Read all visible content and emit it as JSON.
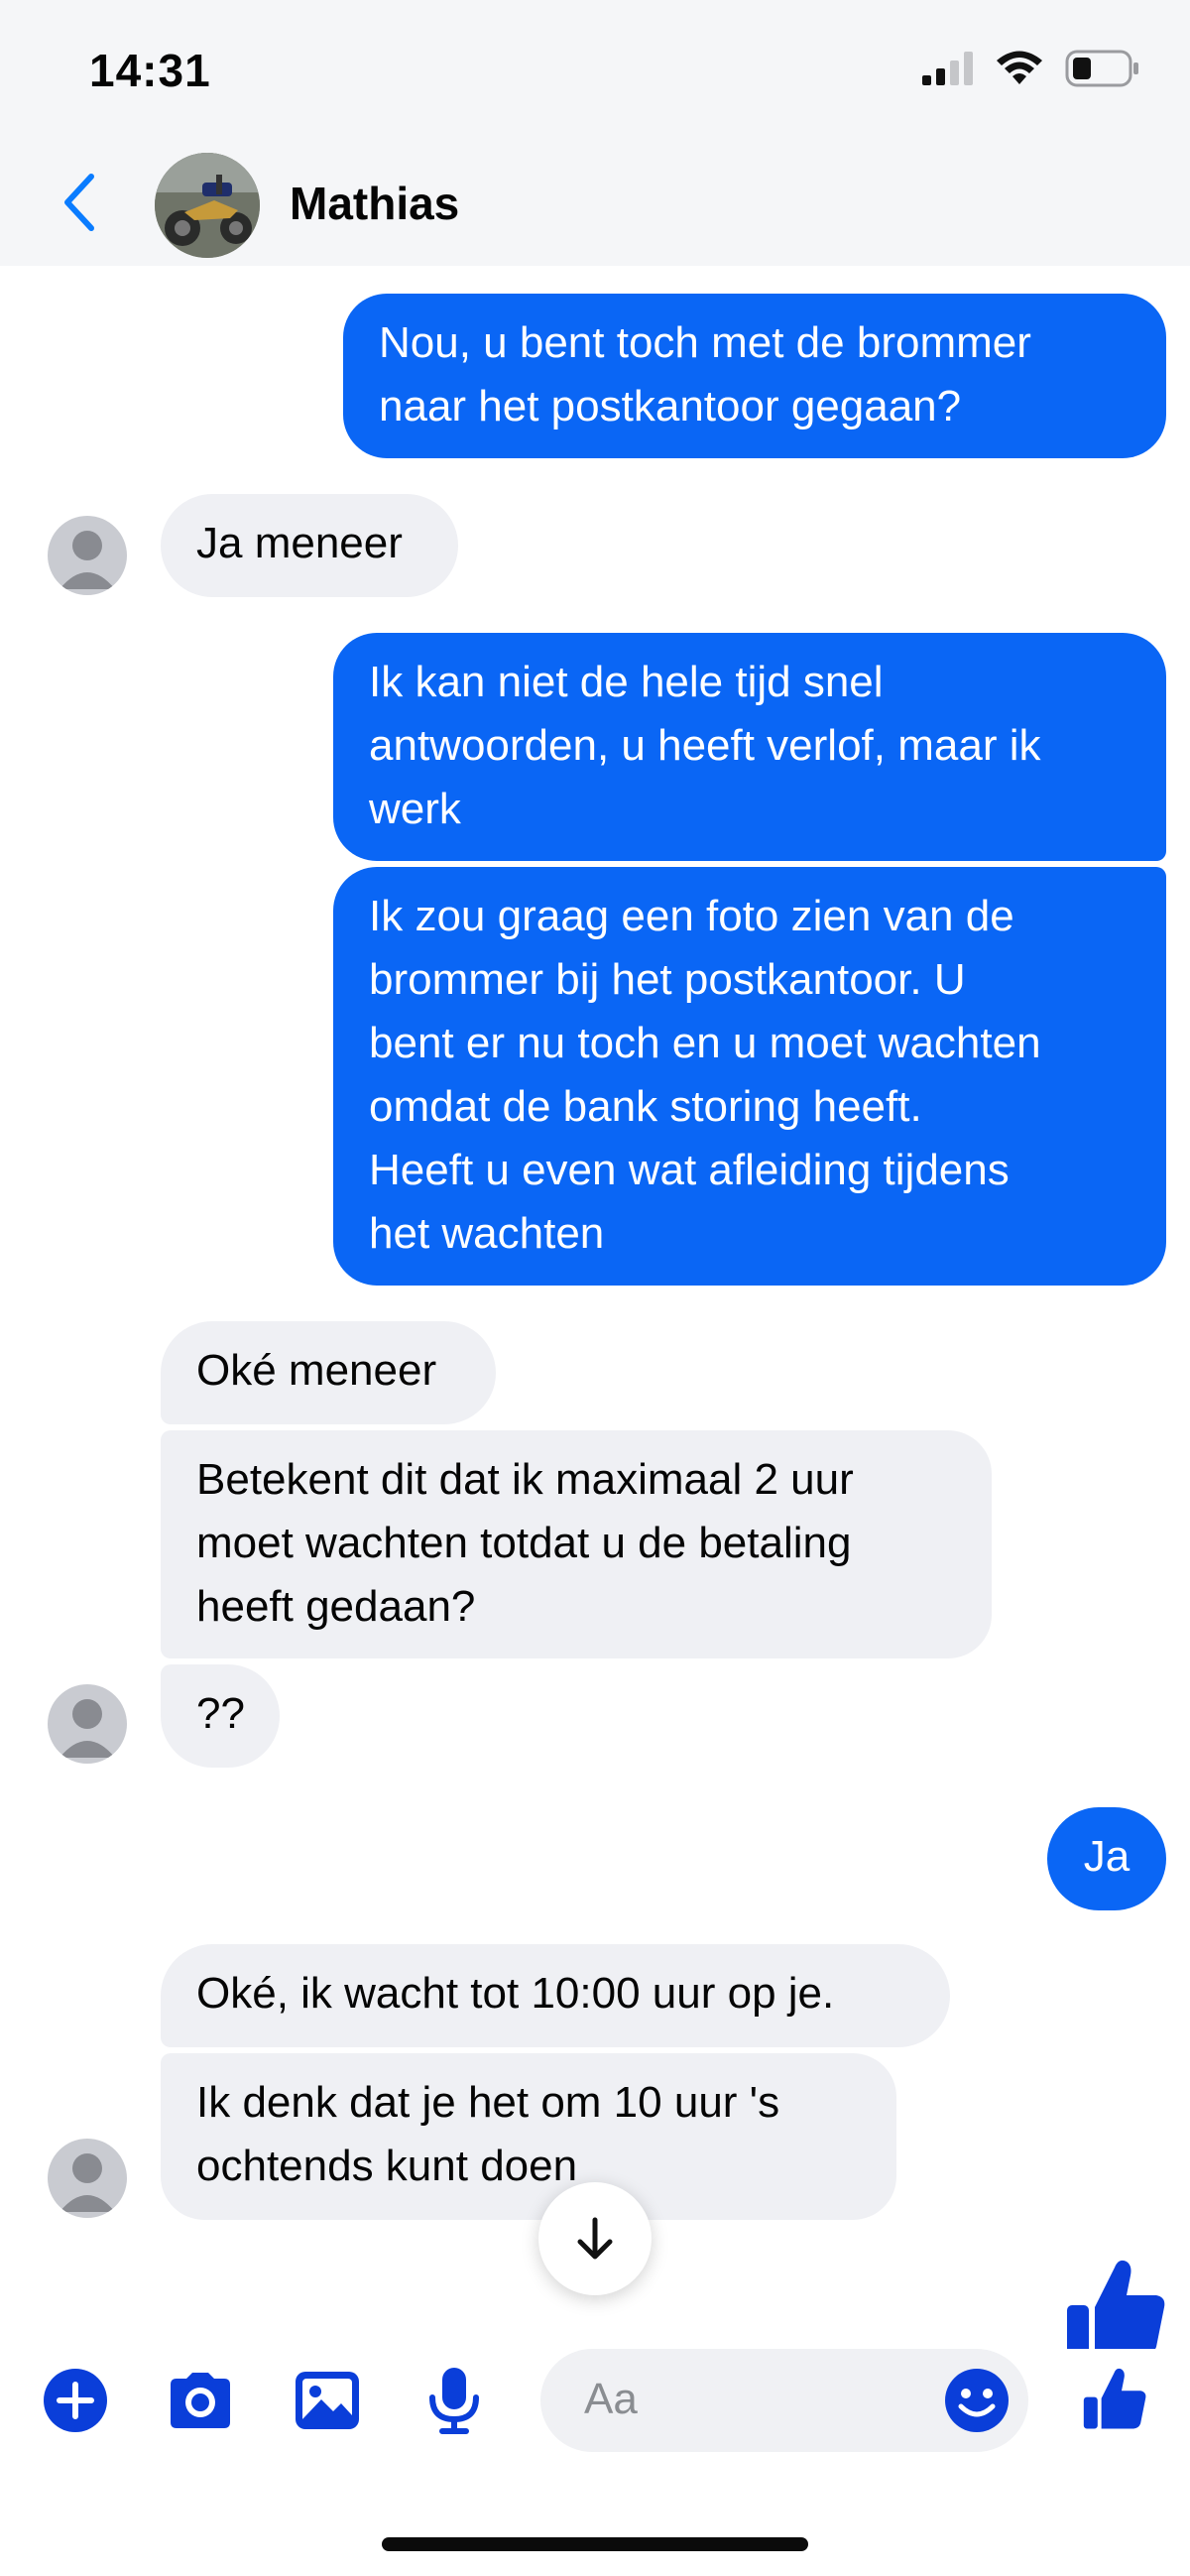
{
  "status_bar": {
    "time": "14:31"
  },
  "header": {
    "contact_name": "Mathias"
  },
  "messages": [
    {
      "side": "out",
      "text": "Nou, u bent toch met de brommer\nnaar het postkantoor gegaan?"
    },
    {
      "side": "in",
      "text": "Ja meneer"
    },
    {
      "side": "out",
      "text": "Ik kan niet de hele tijd snel\nantwoorden, u heeft verlof, maar ik\nwerk"
    },
    {
      "side": "out",
      "text": "Ik zou graag een foto zien van de\nbrommer bij het postkantoor. U\nbent er nu toch en u moet wachten\nomdat de bank storing heeft.\nHeeft u even wat afleiding tijdens\nhet wachten"
    },
    {
      "side": "in",
      "text": "Oké meneer"
    },
    {
      "side": "in",
      "text": "Betekent dit dat ik maximaal 2 uur\nmoet wachten totdat u de betaling\nheeft gedaan?"
    },
    {
      "side": "in",
      "text": "??"
    },
    {
      "side": "out",
      "text": "Ja"
    },
    {
      "side": "in",
      "text": "Oké, ik wacht tot 10:00 uur op je."
    },
    {
      "side": "in",
      "text": "Ik denk dat je het om 10 uur 's\nochtends kunt doen"
    }
  ],
  "composer": {
    "placeholder": "Aa"
  },
  "colors": {
    "outgoing_bubble": "#0a66f5",
    "incoming_bubble": "#eff0f4",
    "accent": "#0a7cff",
    "composer_icons": "#0a3ed9"
  },
  "icons": {
    "back": "chevron-left-icon",
    "add": "plus-circle-icon",
    "camera": "camera-icon",
    "gallery": "image-icon",
    "mic": "microphone-icon",
    "emoji": "smiley-icon",
    "like": "thumbs-up-icon",
    "scroll": "arrow-down-icon"
  }
}
